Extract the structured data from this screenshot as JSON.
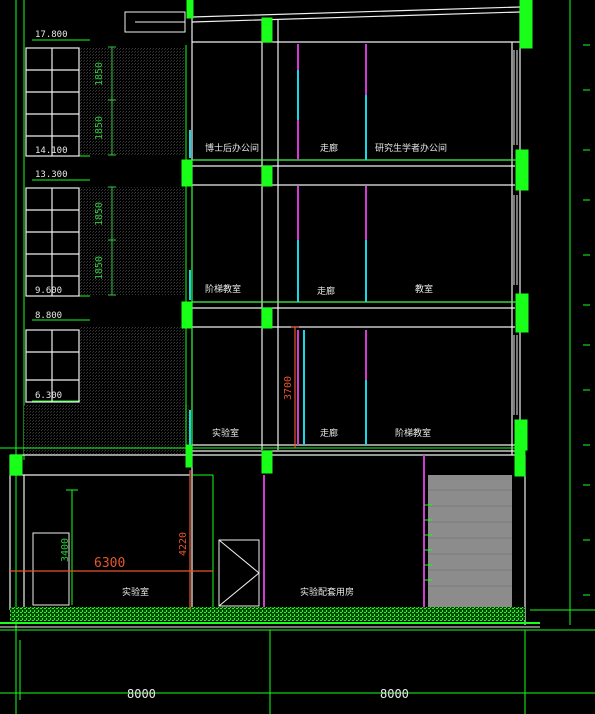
{
  "drawing": {
    "levels": [
      "17.800",
      "14.100",
      "13.300",
      "9.600",
      "8.800",
      "6.300"
    ],
    "window_dims": [
      "1850",
      "1850",
      "1850",
      "1850"
    ],
    "height_dims": [
      "3700",
      "4220",
      "3400"
    ],
    "span_dims": [
      "6300",
      "8000",
      "8000"
    ],
    "rooms": {
      "floor3": [
        "博士后办公间",
        "走廊",
        "研究生学者办公间"
      ],
      "floor2": [
        "阶梯教室",
        "走廊",
        "教室"
      ],
      "floor1": [
        "实验室",
        "走廊",
        "阶梯教室"
      ],
      "ground": [
        "实验室",
        "实验配套用房"
      ]
    },
    "colors": {
      "background": "#000000",
      "line_green": "#19ff19",
      "line_white": "#f0f0f0",
      "dim_green": "#2ec93b",
      "dim_red": "#e8552a",
      "magenta": "#d23bd2",
      "cyan": "#19d8e6",
      "gray_fill": "#8c8c8c"
    }
  }
}
